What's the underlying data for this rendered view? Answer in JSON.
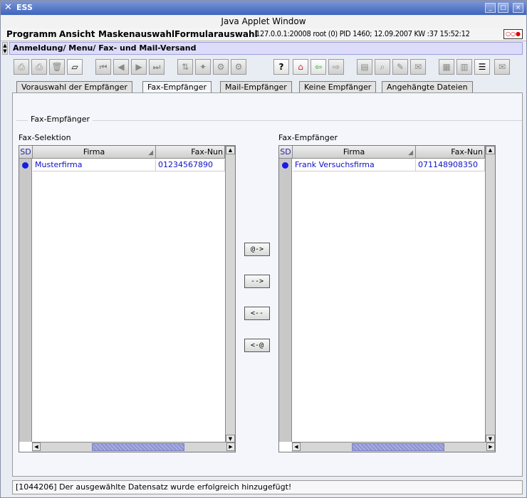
{
  "window": {
    "app_name": "ESS",
    "title": "Java Applet Window",
    "min": "_",
    "max": "□",
    "close": "×"
  },
  "menu": {
    "items": [
      "Programm",
      "Ansicht",
      "Maskenauswahl",
      "Formularauswahl"
    ],
    "status": "127.0.0.1:20008 root (0) PID 1460; 12.09.2007 KW :37 15:52:12",
    "record_indicator": "○○●"
  },
  "breadcrumb": "Anmeldung/ Menu/ Fax- und Mail-Versand",
  "toolbar": {
    "help": "?",
    "icons": [
      "print-all",
      "print",
      "delete",
      "erase",
      "first",
      "prev",
      "next",
      "last",
      "sort",
      "star",
      "tools",
      "tools2",
      "help",
      "home",
      "import",
      "export",
      "doc",
      "search",
      "edit",
      "note",
      "edit2",
      "form",
      "table",
      "mail"
    ]
  },
  "tabs": [
    "Vorauswahl der Empfänger",
    "Fax-Empfänger",
    "Mail-Empfänger",
    "Keine Empfänger",
    "Angehängte Dateien"
  ],
  "group_title": "Fax-Empfänger",
  "left": {
    "label": "Fax-Selektion",
    "col_sd": "SD",
    "col_firma": "Firma",
    "col_fax": "Fax-Nun",
    "row": {
      "firma": "Musterfirma",
      "fax": "01234567890"
    }
  },
  "right": {
    "label": "Fax-Empfänger",
    "col_sd": "SD",
    "col_firma": "Firma",
    "col_fax": "Fax-Nun",
    "row": {
      "firma": "Frank Versuchsfirma",
      "fax": "071148908350"
    }
  },
  "buttons": {
    "add_all": "@->",
    "add": "-->",
    "remove": "<--",
    "remove_all": "<-@"
  },
  "statusbar": "[1044206] Der ausgewählte Datensatz wurde erfolgreich hinzugefügt!"
}
